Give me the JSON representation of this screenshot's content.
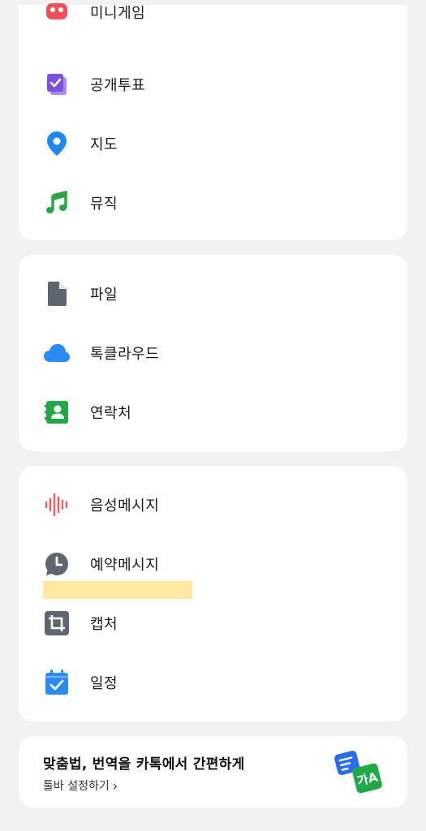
{
  "section1": {
    "items": [
      {
        "label": "미니게임",
        "icon": "minigame-icon"
      },
      {
        "label": "공개투표",
        "icon": "poll-icon"
      },
      {
        "label": "지도",
        "icon": "map-pin-icon"
      },
      {
        "label": "뮤직",
        "icon": "music-note-icon"
      }
    ]
  },
  "section2": {
    "items": [
      {
        "label": "파일",
        "icon": "file-icon"
      },
      {
        "label": "톡클라우드",
        "icon": "cloud-icon"
      },
      {
        "label": "연락처",
        "icon": "contacts-icon"
      }
    ]
  },
  "section3": {
    "items": [
      {
        "label": "음성메시지",
        "icon": "voice-wave-icon"
      },
      {
        "label": "예약메시지",
        "icon": "clock-bubble-icon"
      },
      {
        "label": "캡처",
        "icon": "crop-icon"
      },
      {
        "label": "일정",
        "icon": "calendar-check-icon"
      }
    ]
  },
  "promo": {
    "title": "맞춤법, 번역을 카톡에서 간편하게",
    "link": "툴바 설정하기",
    "link_chevron": "›",
    "art_text": "가A"
  },
  "colors": {
    "minigame": "#f0505a",
    "poll": "#7b4fe0",
    "map": "#1e88f0",
    "music": "#2aa646",
    "file": "#5f6670",
    "cloud": "#2a8cf0",
    "contacts": "#23a848",
    "voice": "#ef5d5d",
    "clock": "#5f6670",
    "crop": "#5f6670",
    "calendar": "#2a8cf0"
  }
}
